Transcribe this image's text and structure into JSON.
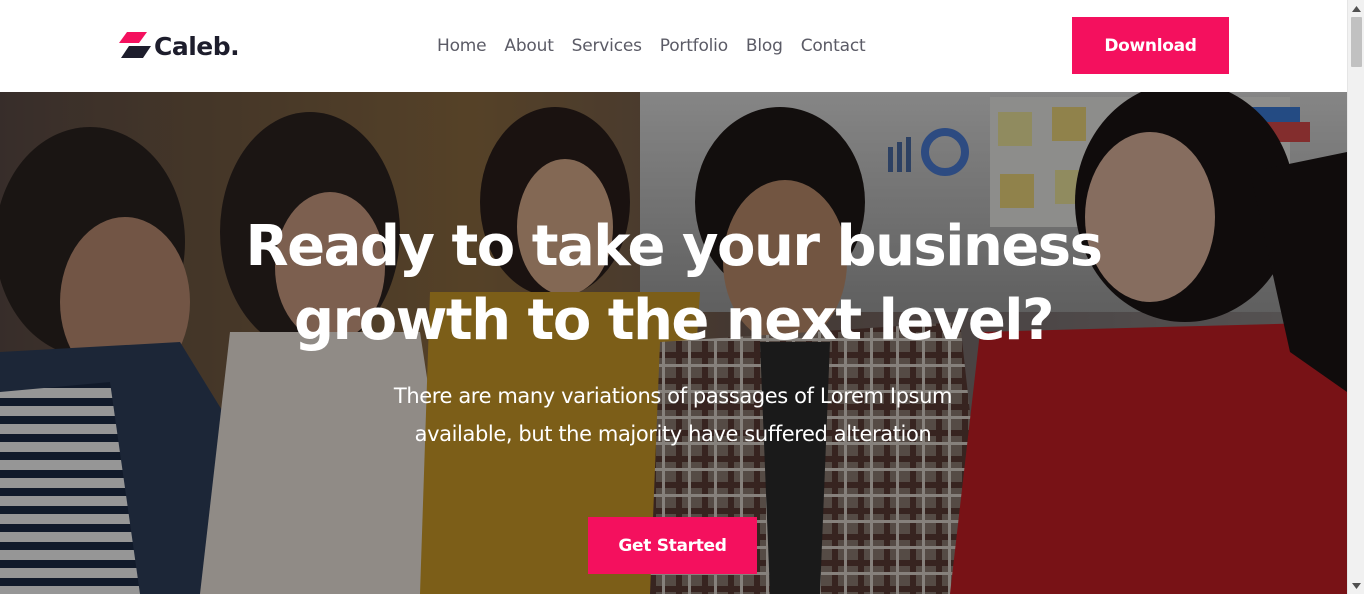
{
  "brand": {
    "name": "Caleb.",
    "accent_color": "#f4105e",
    "logo_icon": "parallelogram-logo-icon"
  },
  "nav": {
    "items": [
      {
        "label": "Home"
      },
      {
        "label": "About"
      },
      {
        "label": "Services"
      },
      {
        "label": "Portfolio"
      },
      {
        "label": "Blog"
      },
      {
        "label": "Contact"
      }
    ]
  },
  "header": {
    "download_label": "Download"
  },
  "hero": {
    "title_line1": "Ready to take your business",
    "title_line2": "growth to the next level?",
    "subtitle": "There are many variations of passages of Lorem Ipsum available, but the majority have suffered alteration",
    "cta_label": "Get Started",
    "background": "team-laughing-photo"
  },
  "scrollbar": {
    "up_icon": "scroll-up-arrow-icon",
    "down_icon": "scroll-down-arrow-icon"
  }
}
